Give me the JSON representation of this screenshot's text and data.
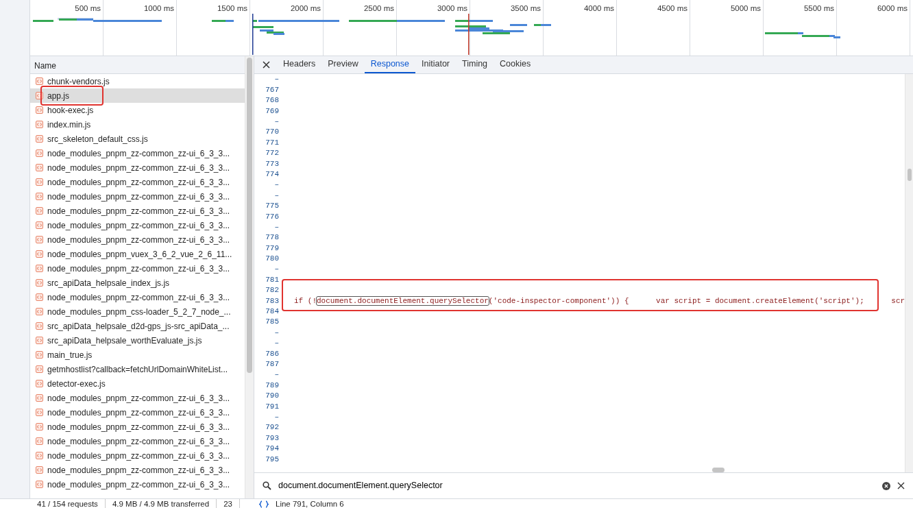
{
  "timeline": {
    "ticks": [
      "500 ms",
      "1000 ms",
      "1500 ms",
      "2000 ms",
      "2500 ms",
      "3000 ms",
      "3500 ms",
      "4000 ms",
      "4500 ms",
      "5000 ms",
      "5500 ms",
      "6000 ms"
    ]
  },
  "request_list": {
    "header": "Name",
    "rows": [
      {
        "name": "chunk-vendors.js",
        "selected": false,
        "annotated": false
      },
      {
        "name": "app.js",
        "selected": true,
        "annotated": true
      },
      {
        "name": "hook-exec.js",
        "selected": false,
        "annotated": false
      },
      {
        "name": "index.min.js",
        "selected": false,
        "annotated": false
      },
      {
        "name": "src_skeleton_default_css.js",
        "selected": false,
        "annotated": false
      },
      {
        "name": "node_modules_pnpm_zz-common_zz-ui_6_3_3...",
        "selected": false,
        "annotated": false
      },
      {
        "name": "node_modules_pnpm_zz-common_zz-ui_6_3_3...",
        "selected": false,
        "annotated": false
      },
      {
        "name": "node_modules_pnpm_zz-common_zz-ui_6_3_3...",
        "selected": false,
        "annotated": false
      },
      {
        "name": "node_modules_pnpm_zz-common_zz-ui_6_3_3...",
        "selected": false,
        "annotated": false
      },
      {
        "name": "node_modules_pnpm_zz-common_zz-ui_6_3_3...",
        "selected": false,
        "annotated": false
      },
      {
        "name": "node_modules_pnpm_zz-common_zz-ui_6_3_3...",
        "selected": false,
        "annotated": false
      },
      {
        "name": "node_modules_pnpm_zz-common_zz-ui_6_3_3...",
        "selected": false,
        "annotated": false
      },
      {
        "name": "node_modules_pnpm_vuex_3_6_2_vue_2_6_11...",
        "selected": false,
        "annotated": false
      },
      {
        "name": "node_modules_pnpm_zz-common_zz-ui_6_3_3...",
        "selected": false,
        "annotated": false
      },
      {
        "name": "src_apiData_helpsale_index_js.js",
        "selected": false,
        "annotated": false
      },
      {
        "name": "node_modules_pnpm_zz-common_zz-ui_6_3_3...",
        "selected": false,
        "annotated": false
      },
      {
        "name": "node_modules_pnpm_css-loader_5_2_7_node_...",
        "selected": false,
        "annotated": false
      },
      {
        "name": "src_apiData_helpsale_d2d-gps_js-src_apiData_...",
        "selected": false,
        "annotated": false
      },
      {
        "name": "src_apiData_helpsale_worthEvaluate_js.js",
        "selected": false,
        "annotated": false
      },
      {
        "name": "main_true.js",
        "selected": false,
        "annotated": false
      },
      {
        "name": "getmhostlist?callback=fetchUrlDomainWhiteList...",
        "selected": false,
        "annotated": false
      },
      {
        "name": "detector-exec.js",
        "selected": false,
        "annotated": false
      },
      {
        "name": "node_modules_pnpm_zz-common_zz-ui_6_3_3...",
        "selected": false,
        "annotated": false
      },
      {
        "name": "node_modules_pnpm_zz-common_zz-ui_6_3_3...",
        "selected": false,
        "annotated": false
      },
      {
        "name": "node_modules_pnpm_zz-common_zz-ui_6_3_3...",
        "selected": false,
        "annotated": false
      },
      {
        "name": "node_modules_pnpm_zz-common_zz-ui_6_3_3...",
        "selected": false,
        "annotated": false
      },
      {
        "name": "node_modules_pnpm_zz-common_zz-ui_6_3_3...",
        "selected": false,
        "annotated": false
      },
      {
        "name": "node_modules_pnpm_zz-common_zz-ui_6_3_3...",
        "selected": false,
        "annotated": false
      },
      {
        "name": "node_modules_pnpm_zz-common_zz-ui_6_3_3...",
        "selected": false,
        "annotated": false
      }
    ]
  },
  "detail_tabs": [
    {
      "label": "Headers",
      "selected": false
    },
    {
      "label": "Preview",
      "selected": false
    },
    {
      "label": "Response",
      "selected": true
    },
    {
      "label": "Initiator",
      "selected": false
    },
    {
      "label": "Timing",
      "selected": false
    },
    {
      "label": "Cookies",
      "selected": false
    }
  ],
  "response": {
    "lines": [
      {
        "number": "–"
      },
      {
        "number": "767"
      },
      {
        "number": "768"
      },
      {
        "number": "769"
      },
      {
        "number": "–"
      },
      {
        "number": "770"
      },
      {
        "number": "771"
      },
      {
        "number": "772"
      },
      {
        "number": "773"
      },
      {
        "number": "774"
      },
      {
        "number": "–"
      },
      {
        "number": "–"
      },
      {
        "number": "775"
      },
      {
        "number": "776"
      },
      {
        "number": "–"
      },
      {
        "number": "778"
      },
      {
        "number": "779"
      },
      {
        "number": "780"
      },
      {
        "number": "–"
      },
      {
        "number": "781"
      },
      {
        "number": "782"
      },
      {
        "number": "783",
        "annotated": true,
        "code_before": "if (!",
        "match": "document.documentElement.querySelector",
        "code_after": "('code-inspector-component')) {      var script = document.createElement('script');      scr"
      },
      {
        "number": "784"
      },
      {
        "number": "785"
      },
      {
        "number": "–"
      },
      {
        "number": "–"
      },
      {
        "number": "786"
      },
      {
        "number": "787"
      },
      {
        "number": "–"
      },
      {
        "number": "789"
      },
      {
        "number": "790"
      },
      {
        "number": "791"
      },
      {
        "number": "–"
      },
      {
        "number": "792"
      },
      {
        "number": "793"
      },
      {
        "number": "794"
      },
      {
        "number": "795"
      }
    ]
  },
  "search": {
    "value": "document.documentElement.querySelector"
  },
  "status_bar": {
    "items": [
      "41 / 154 requests",
      "4.9 MB / 4.9 MB transferred",
      "23"
    ],
    "position": "Line 791, Column 6"
  }
}
